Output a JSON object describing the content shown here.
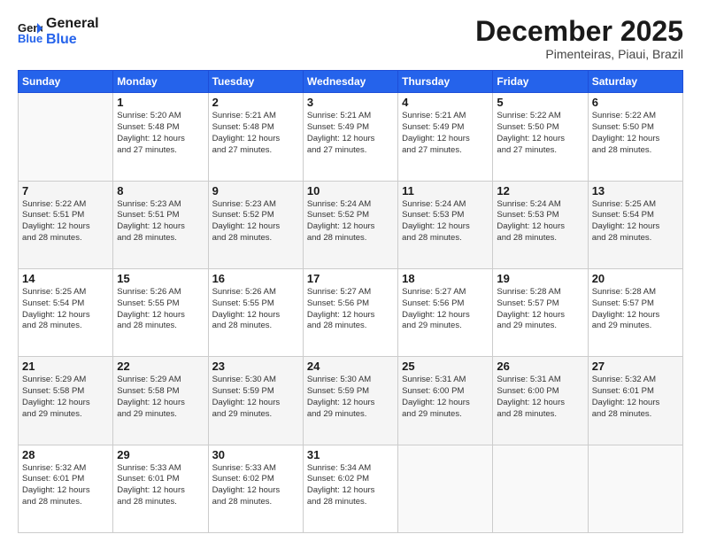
{
  "logo": {
    "line1": "General",
    "line2": "Blue"
  },
  "header": {
    "month": "December 2025",
    "location": "Pimenteiras, Piaui, Brazil"
  },
  "days_of_week": [
    "Sunday",
    "Monday",
    "Tuesday",
    "Wednesday",
    "Thursday",
    "Friday",
    "Saturday"
  ],
  "weeks": [
    [
      {
        "day": "",
        "info": ""
      },
      {
        "day": "1",
        "info": "Sunrise: 5:20 AM\nSunset: 5:48 PM\nDaylight: 12 hours\nand 27 minutes."
      },
      {
        "day": "2",
        "info": "Sunrise: 5:21 AM\nSunset: 5:48 PM\nDaylight: 12 hours\nand 27 minutes."
      },
      {
        "day": "3",
        "info": "Sunrise: 5:21 AM\nSunset: 5:49 PM\nDaylight: 12 hours\nand 27 minutes."
      },
      {
        "day": "4",
        "info": "Sunrise: 5:21 AM\nSunset: 5:49 PM\nDaylight: 12 hours\nand 27 minutes."
      },
      {
        "day": "5",
        "info": "Sunrise: 5:22 AM\nSunset: 5:50 PM\nDaylight: 12 hours\nand 27 minutes."
      },
      {
        "day": "6",
        "info": "Sunrise: 5:22 AM\nSunset: 5:50 PM\nDaylight: 12 hours\nand 28 minutes."
      }
    ],
    [
      {
        "day": "7",
        "info": "Sunrise: 5:22 AM\nSunset: 5:51 PM\nDaylight: 12 hours\nand 28 minutes."
      },
      {
        "day": "8",
        "info": "Sunrise: 5:23 AM\nSunset: 5:51 PM\nDaylight: 12 hours\nand 28 minutes."
      },
      {
        "day": "9",
        "info": "Sunrise: 5:23 AM\nSunset: 5:52 PM\nDaylight: 12 hours\nand 28 minutes."
      },
      {
        "day": "10",
        "info": "Sunrise: 5:24 AM\nSunset: 5:52 PM\nDaylight: 12 hours\nand 28 minutes."
      },
      {
        "day": "11",
        "info": "Sunrise: 5:24 AM\nSunset: 5:53 PM\nDaylight: 12 hours\nand 28 minutes."
      },
      {
        "day": "12",
        "info": "Sunrise: 5:24 AM\nSunset: 5:53 PM\nDaylight: 12 hours\nand 28 minutes."
      },
      {
        "day": "13",
        "info": "Sunrise: 5:25 AM\nSunset: 5:54 PM\nDaylight: 12 hours\nand 28 minutes."
      }
    ],
    [
      {
        "day": "14",
        "info": "Sunrise: 5:25 AM\nSunset: 5:54 PM\nDaylight: 12 hours\nand 28 minutes."
      },
      {
        "day": "15",
        "info": "Sunrise: 5:26 AM\nSunset: 5:55 PM\nDaylight: 12 hours\nand 28 minutes."
      },
      {
        "day": "16",
        "info": "Sunrise: 5:26 AM\nSunset: 5:55 PM\nDaylight: 12 hours\nand 28 minutes."
      },
      {
        "day": "17",
        "info": "Sunrise: 5:27 AM\nSunset: 5:56 PM\nDaylight: 12 hours\nand 28 minutes."
      },
      {
        "day": "18",
        "info": "Sunrise: 5:27 AM\nSunset: 5:56 PM\nDaylight: 12 hours\nand 29 minutes."
      },
      {
        "day": "19",
        "info": "Sunrise: 5:28 AM\nSunset: 5:57 PM\nDaylight: 12 hours\nand 29 minutes."
      },
      {
        "day": "20",
        "info": "Sunrise: 5:28 AM\nSunset: 5:57 PM\nDaylight: 12 hours\nand 29 minutes."
      }
    ],
    [
      {
        "day": "21",
        "info": "Sunrise: 5:29 AM\nSunset: 5:58 PM\nDaylight: 12 hours\nand 29 minutes."
      },
      {
        "day": "22",
        "info": "Sunrise: 5:29 AM\nSunset: 5:58 PM\nDaylight: 12 hours\nand 29 minutes."
      },
      {
        "day": "23",
        "info": "Sunrise: 5:30 AM\nSunset: 5:59 PM\nDaylight: 12 hours\nand 29 minutes."
      },
      {
        "day": "24",
        "info": "Sunrise: 5:30 AM\nSunset: 5:59 PM\nDaylight: 12 hours\nand 29 minutes."
      },
      {
        "day": "25",
        "info": "Sunrise: 5:31 AM\nSunset: 6:00 PM\nDaylight: 12 hours\nand 29 minutes."
      },
      {
        "day": "26",
        "info": "Sunrise: 5:31 AM\nSunset: 6:00 PM\nDaylight: 12 hours\nand 28 minutes."
      },
      {
        "day": "27",
        "info": "Sunrise: 5:32 AM\nSunset: 6:01 PM\nDaylight: 12 hours\nand 28 minutes."
      }
    ],
    [
      {
        "day": "28",
        "info": "Sunrise: 5:32 AM\nSunset: 6:01 PM\nDaylight: 12 hours\nand 28 minutes."
      },
      {
        "day": "29",
        "info": "Sunrise: 5:33 AM\nSunset: 6:01 PM\nDaylight: 12 hours\nand 28 minutes."
      },
      {
        "day": "30",
        "info": "Sunrise: 5:33 AM\nSunset: 6:02 PM\nDaylight: 12 hours\nand 28 minutes."
      },
      {
        "day": "31",
        "info": "Sunrise: 5:34 AM\nSunset: 6:02 PM\nDaylight: 12 hours\nand 28 minutes."
      },
      {
        "day": "",
        "info": ""
      },
      {
        "day": "",
        "info": ""
      },
      {
        "day": "",
        "info": ""
      }
    ]
  ]
}
